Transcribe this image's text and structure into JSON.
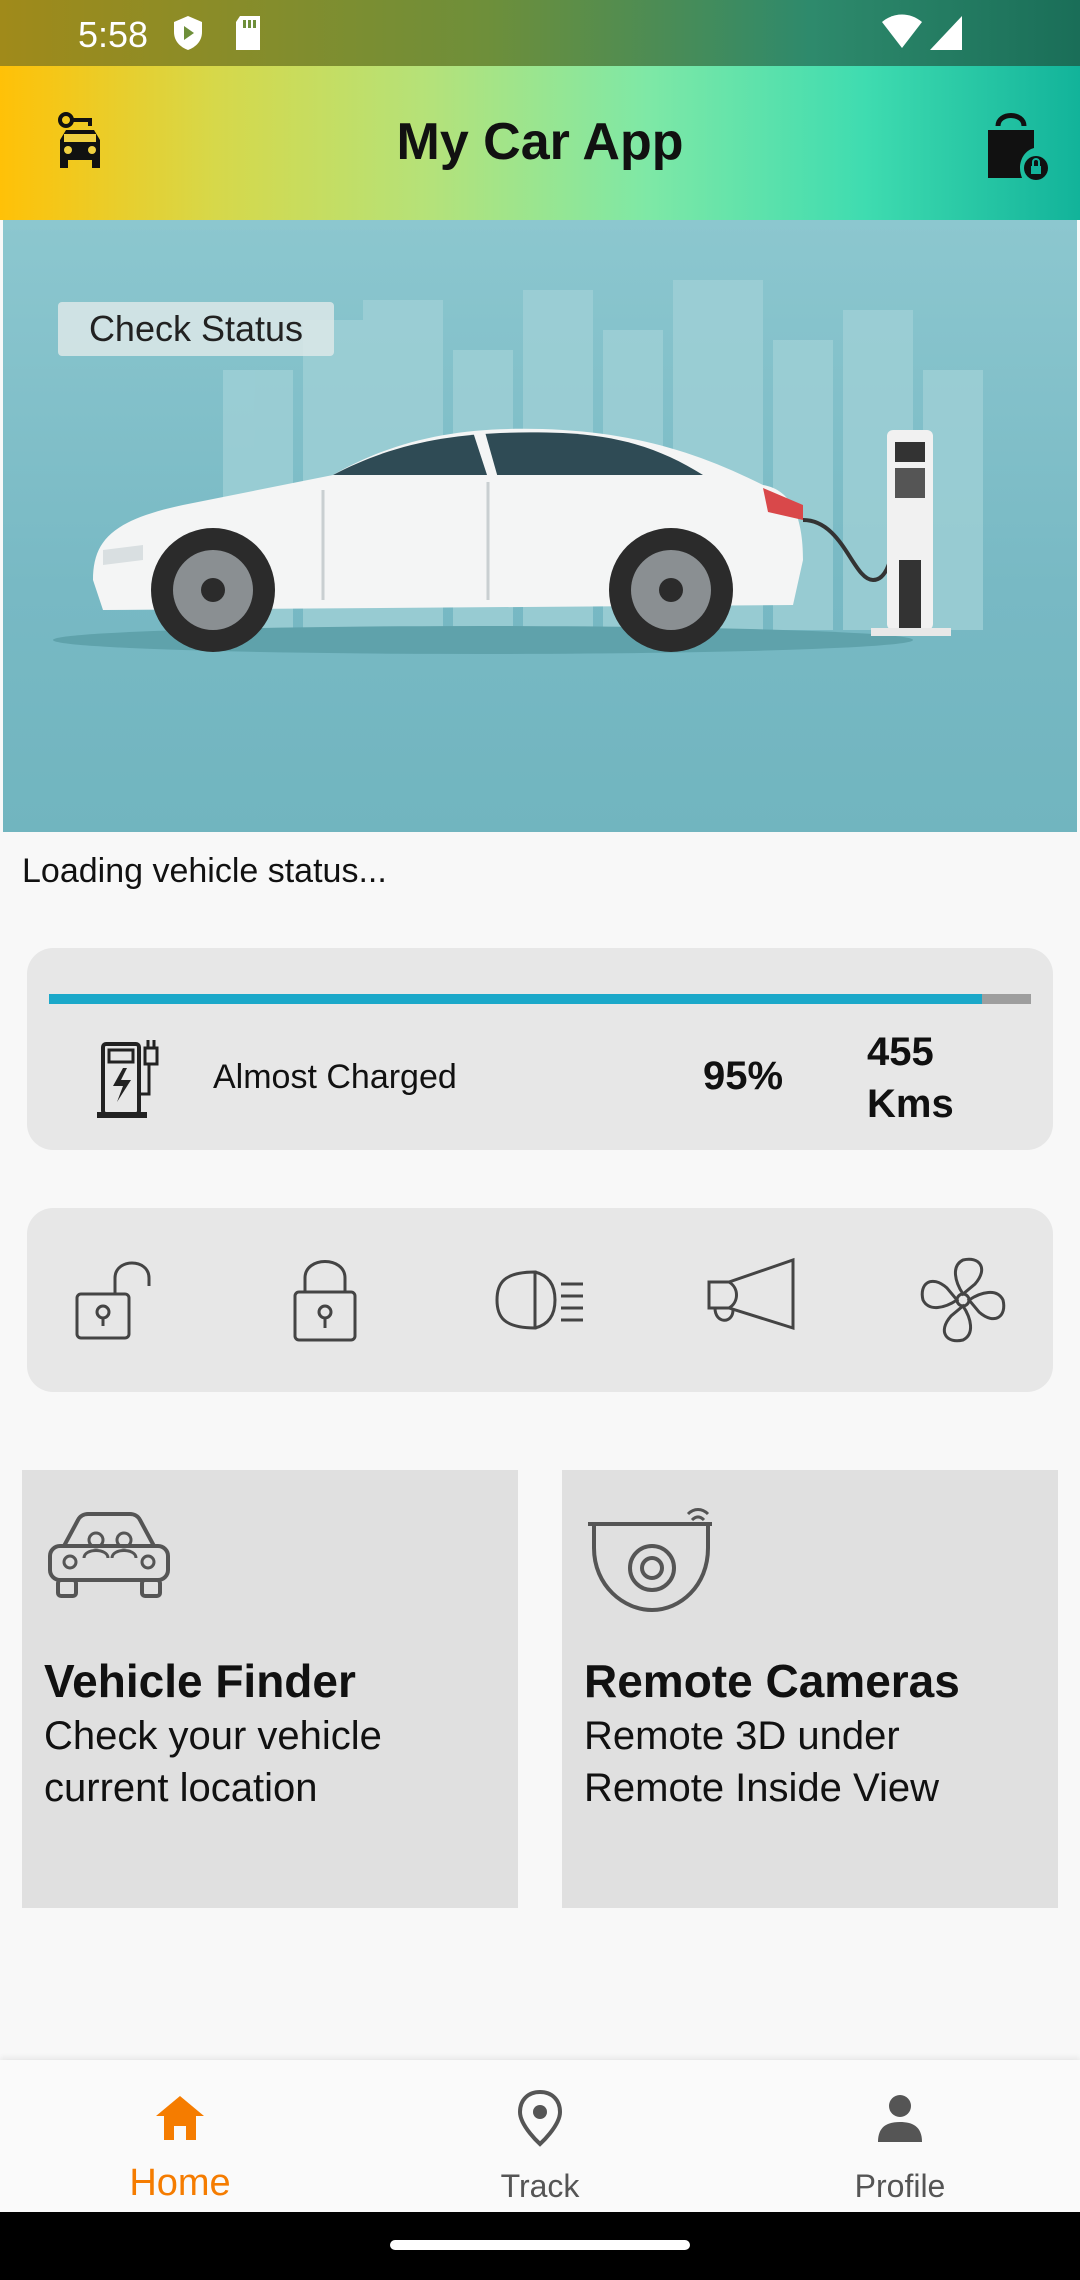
{
  "status_bar": {
    "time": "5:58"
  },
  "app_bar": {
    "title": "My Car App"
  },
  "hero": {
    "check_status_label": "Check Status"
  },
  "loading_text": "Loading vehicle status...",
  "charge": {
    "label": "Almost Charged",
    "percent_text": "95%",
    "percent": 95,
    "range_text": "455 Kms",
    "bar_color": "#1ba8c9"
  },
  "controls": [
    {
      "icon": "unlock-icon"
    },
    {
      "icon": "lock-icon"
    },
    {
      "icon": "headlight-icon"
    },
    {
      "icon": "horn-icon"
    },
    {
      "icon": "fan-icon"
    }
  ],
  "features": [
    {
      "title": "Vehicle Finder",
      "description": "Check your vehicle current location",
      "icon": "car-icon"
    },
    {
      "title": "Remote Cameras",
      "description": "Remote 3D under Remote Inside View",
      "icon": "camera-icon"
    }
  ],
  "bottom_nav": {
    "items": [
      {
        "label": "Home",
        "icon": "home-icon",
        "active": true
      },
      {
        "label": "Track",
        "icon": "location-pin-icon",
        "active": false
      },
      {
        "label": "Profile",
        "icon": "person-icon",
        "active": false
      }
    ],
    "active_color": "#f57c00"
  }
}
